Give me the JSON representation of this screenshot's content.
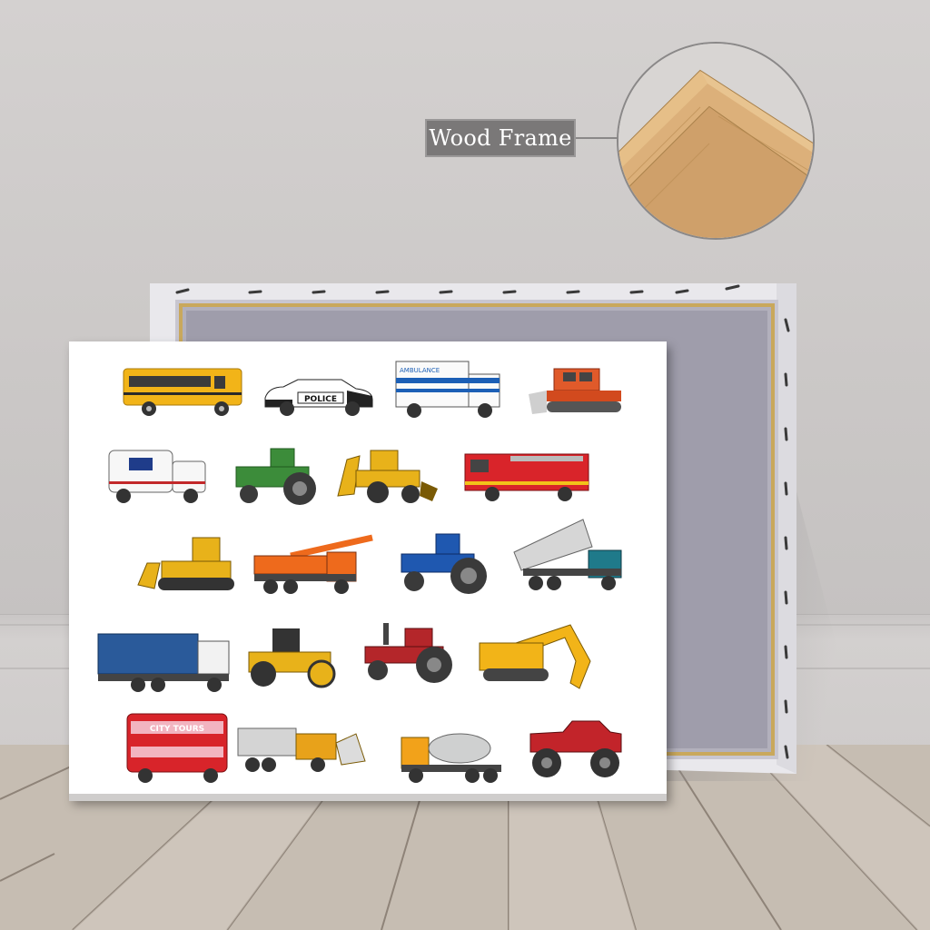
{
  "label": {
    "text": "Wood Frame"
  },
  "colors": {
    "wall": "#d4d1d0",
    "floor": "#c8c0b6",
    "label_bg": "#7a7878",
    "wood": "#d9b07a"
  },
  "vehicles": [
    {
      "name": "school-bus",
      "row": 0,
      "col": 0
    },
    {
      "name": "police-car",
      "row": 0,
      "col": 1,
      "text": "POLICE"
    },
    {
      "name": "ambulance",
      "row": 0,
      "col": 2,
      "text": "AMBULANCE"
    },
    {
      "name": "snowcat",
      "row": 0,
      "col": 3
    },
    {
      "name": "mail-truck",
      "row": 1,
      "col": 0
    },
    {
      "name": "green-tractor",
      "row": 1,
      "col": 1
    },
    {
      "name": "backhoe-loader",
      "row": 1,
      "col": 2
    },
    {
      "name": "fire-truck",
      "row": 1,
      "col": 3
    },
    {
      "name": "bulldozer",
      "row": 2,
      "col": 0
    },
    {
      "name": "crane-truck",
      "row": 2,
      "col": 1
    },
    {
      "name": "blue-tractor",
      "row": 2,
      "col": 2
    },
    {
      "name": "dump-truck",
      "row": 2,
      "col": 3
    },
    {
      "name": "garbage-truck",
      "row": 3,
      "col": 0
    },
    {
      "name": "road-roller",
      "row": 3,
      "col": 1
    },
    {
      "name": "red-tractor",
      "row": 3,
      "col": 2
    },
    {
      "name": "excavator",
      "row": 3,
      "col": 3
    },
    {
      "name": "double-decker-bus",
      "row": 4,
      "col": 0,
      "text": "CITY TOURS"
    },
    {
      "name": "snowplow-truck",
      "row": 4,
      "col": 1
    },
    {
      "name": "cement-mixer",
      "row": 4,
      "col": 2
    },
    {
      "name": "monster-truck",
      "row": 4,
      "col": 3
    }
  ]
}
